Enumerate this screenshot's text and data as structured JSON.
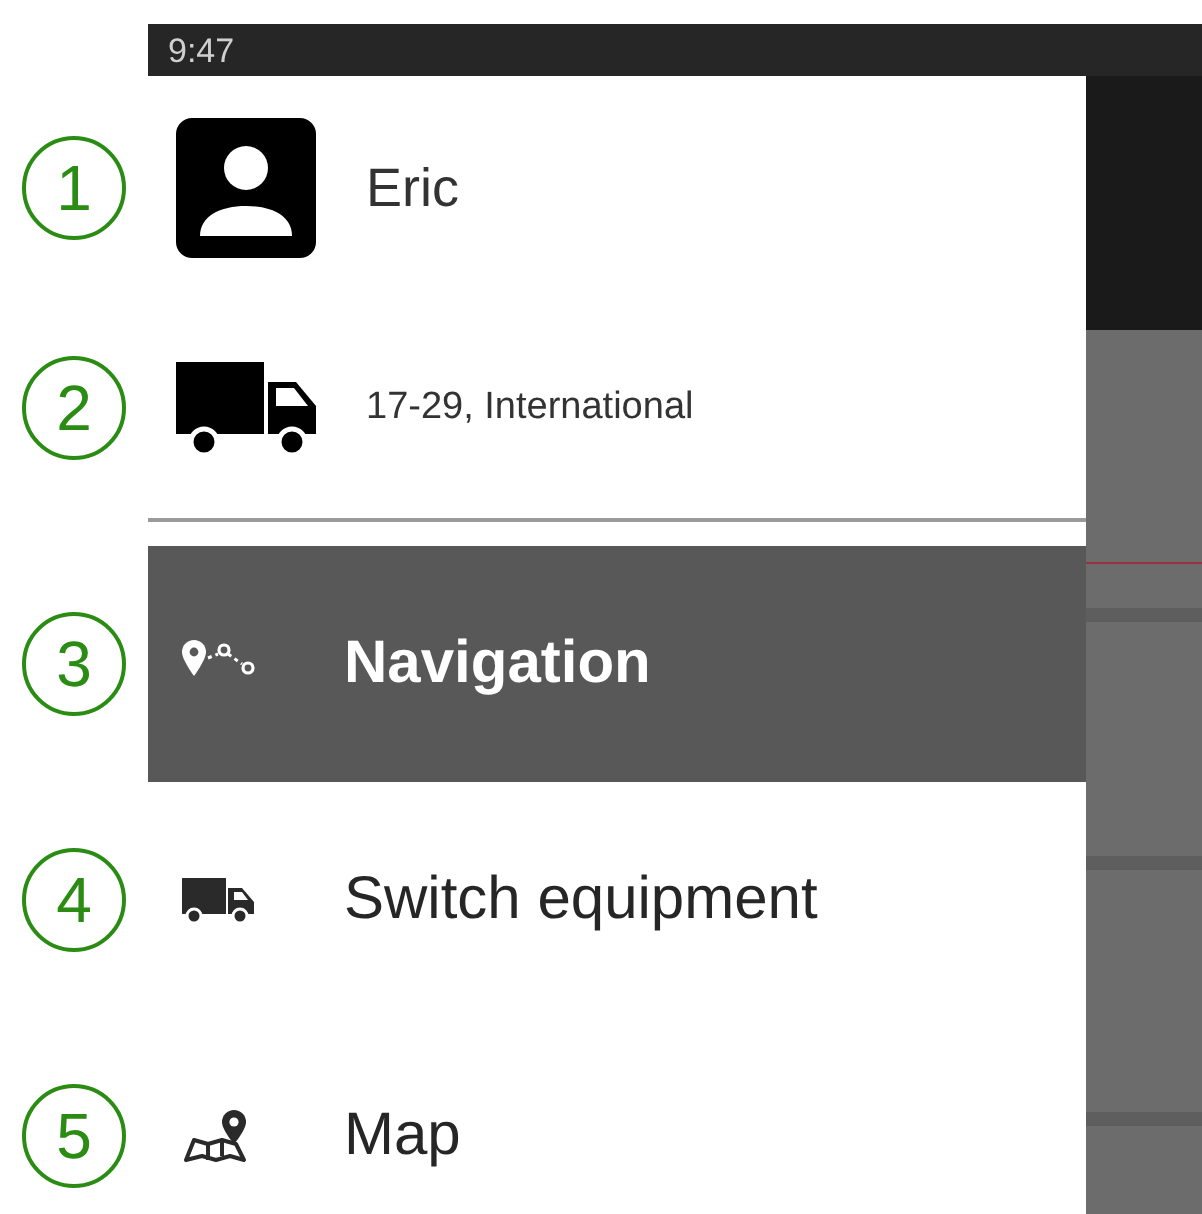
{
  "status_bar": {
    "time": "9:47"
  },
  "header": {
    "user": {
      "callout": "1",
      "name": "Eric"
    },
    "equipment": {
      "callout": "2",
      "label": "17-29, International"
    }
  },
  "menu": [
    {
      "callout": "3",
      "kind": "route",
      "label": "Navigation",
      "selected": true
    },
    {
      "callout": "4",
      "kind": "truck",
      "label": "Switch equipment",
      "selected": false
    },
    {
      "callout": "5",
      "kind": "map",
      "label": "Map",
      "selected": false
    }
  ]
}
